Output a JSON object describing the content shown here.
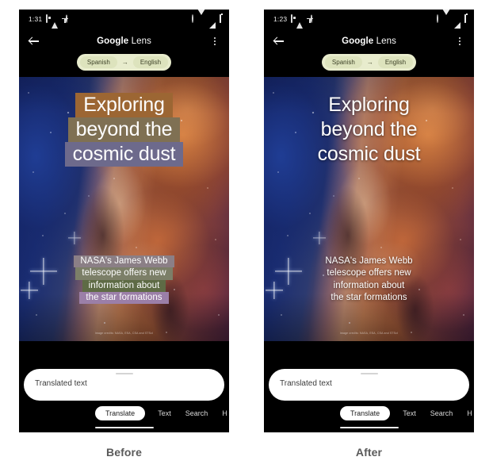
{
  "panels": [
    {
      "caption": "Before",
      "variant": "before",
      "status": {
        "time": "1:31",
        "left_icons": [
          "screenshot-icon",
          "warning-triangle-icon",
          "download-icon",
          "sync-icon"
        ],
        "right_icons": [
          "alarm-icon",
          "wifi-icon",
          "signal-icon",
          "battery-icon"
        ]
      },
      "app_bar": {
        "back_label": "Back",
        "title_bold": "Google",
        "title_light": " Lens",
        "overflow_label": "More options"
      },
      "language": {
        "source": "Spanish",
        "arrow": "→",
        "target": "English"
      },
      "overlay": {
        "headline": [
          {
            "text": "Exploring",
            "box": "#9c6633"
          },
          {
            "text": "beyond the",
            "box": "#7f7053"
          },
          {
            "text": "cosmic dust",
            "box": "#6d6a8c"
          }
        ],
        "body": [
          {
            "text": "NASA's James Webb",
            "box": "#8b7f86"
          },
          {
            "text": "telescope offers new",
            "box": "#7c7f68"
          },
          {
            "text": "information about",
            "box": "#5e6b45"
          },
          {
            "text": "the star formations",
            "box": "#9b7fa8"
          }
        ]
      },
      "watermark": "Image credits: NASA, ESA, CSA and STScI",
      "sheet": {
        "placeholder": "Translated text",
        "tabs": [
          {
            "label": "Translate",
            "active": true
          },
          {
            "label": "Text",
            "active": false
          },
          {
            "label": "Search",
            "active": false
          },
          {
            "label": "H",
            "active": false
          }
        ]
      }
    },
    {
      "caption": "After",
      "variant": "after",
      "status": {
        "time": "1:23",
        "left_icons": [
          "screenshot-icon",
          "warning-triangle-icon",
          "download-icon",
          "sync-icon"
        ],
        "right_icons": [
          "alarm-icon",
          "wifi-icon",
          "signal-icon",
          "battery-icon"
        ]
      },
      "app_bar": {
        "back_label": "Back",
        "title_bold": "Google",
        "title_light": " Lens",
        "overflow_label": "More options"
      },
      "language": {
        "source": "Spanish",
        "arrow": "→",
        "target": "English"
      },
      "overlay": {
        "headline": [
          {
            "text": "Exploring",
            "box": "transparent"
          },
          {
            "text": "beyond the",
            "box": "transparent"
          },
          {
            "text": "cosmic dust",
            "box": "transparent"
          }
        ],
        "body": [
          {
            "text": "NASA's James Webb",
            "box": "transparent"
          },
          {
            "text": "telescope offers new",
            "box": "transparent"
          },
          {
            "text": "information about",
            "box": "transparent"
          },
          {
            "text": "the star formations",
            "box": "transparent"
          }
        ]
      },
      "watermark": "Image credits: NASA, ESA, CSA and STScI",
      "sheet": {
        "placeholder": "Translated text",
        "tabs": [
          {
            "label": "Translate",
            "active": true
          },
          {
            "label": "Text",
            "active": false
          },
          {
            "label": "Search",
            "active": false
          },
          {
            "label": "H",
            "active": false
          }
        ]
      }
    }
  ],
  "colors": {
    "page_background": "#ffffff",
    "phone_background": "#000000",
    "caption_text": "#5a5a5a",
    "language_pill": "#e8eccd",
    "language_chip": "#dde3bd",
    "sheet_card": "#ffffff",
    "active_tab": "#ffffff"
  }
}
